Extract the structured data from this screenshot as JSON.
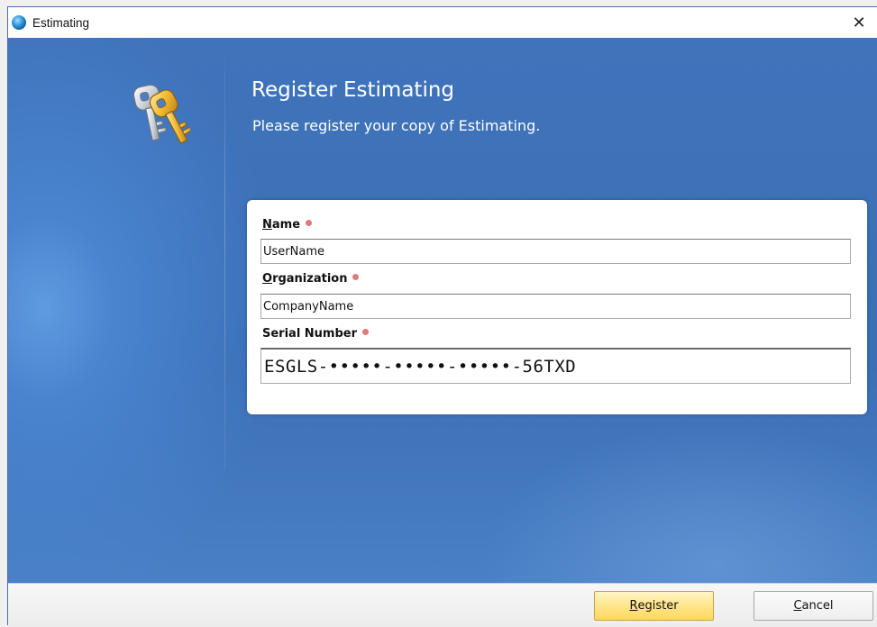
{
  "window": {
    "title": "Estimating",
    "close_glyph": "✕"
  },
  "header": {
    "heading": "Register Estimating",
    "subheading": "Please register your copy of Estimating.",
    "icon": "keys-icon"
  },
  "form": {
    "name": {
      "label_access": "N",
      "label_rest": "ame",
      "value": "UserName"
    },
    "organization": {
      "label_access": "O",
      "label_rest": "rganization",
      "value": "CompanyName"
    },
    "serial": {
      "label": "Serial Number",
      "value": "ESGLS-•••••-•••••-•••••-56TXD"
    },
    "required_color": "#e07a7a"
  },
  "buttons": {
    "register_access": "R",
    "register_rest": "egister",
    "cancel_access": "C",
    "cancel_rest": "ancel"
  },
  "colors": {
    "accent_blue": "#3f73ba",
    "register_button": "#ffe58a"
  }
}
